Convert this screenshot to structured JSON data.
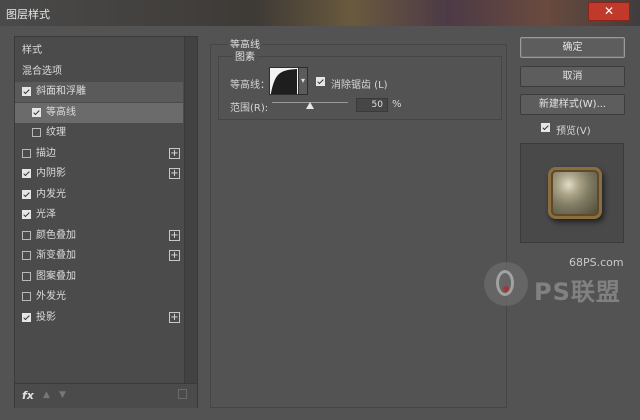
{
  "window": {
    "title": "图层样式",
    "close_icon": "✕",
    "close_color": "#c0392b"
  },
  "left_panel": {
    "items": [
      {
        "label": "样式",
        "checkbox": null,
        "plus": false,
        "state": ""
      },
      {
        "label": "混合选项",
        "checkbox": null,
        "plus": false,
        "state": ""
      },
      {
        "label": "斜面和浮雕",
        "checkbox": true,
        "plus": false,
        "state": "sel-head"
      },
      {
        "label": "等高线",
        "checkbox": true,
        "plus": false,
        "state": "sel",
        "indent": true
      },
      {
        "label": "纹理",
        "checkbox": false,
        "plus": false,
        "state": "",
        "indent": true
      },
      {
        "label": "描边",
        "checkbox": false,
        "plus": true,
        "state": ""
      },
      {
        "label": "内阴影",
        "checkbox": true,
        "plus": true,
        "state": ""
      },
      {
        "label": "内发光",
        "checkbox": true,
        "plus": false,
        "state": ""
      },
      {
        "label": "光泽",
        "checkbox": true,
        "plus": false,
        "state": ""
      },
      {
        "label": "颜色叠加",
        "checkbox": false,
        "plus": true,
        "state": ""
      },
      {
        "label": "渐变叠加",
        "checkbox": false,
        "plus": true,
        "state": ""
      },
      {
        "label": "图案叠加",
        "checkbox": false,
        "plus": false,
        "state": ""
      },
      {
        "label": "外发光",
        "checkbox": false,
        "plus": false,
        "state": ""
      },
      {
        "label": "投影",
        "checkbox": true,
        "plus": true,
        "state": ""
      }
    ],
    "footer": {
      "fx_label": "fx",
      "up_icon": "▲",
      "down_icon": "▼"
    }
  },
  "contour": {
    "group_title": "等高线",
    "sub_title": "图素",
    "contour_label": "等高线：",
    "dropdown_icon": "▾",
    "antialias_label": "消除锯齿 (L)",
    "antialias_checked": true,
    "range_label": "范围(R):",
    "range_value": "50",
    "range_unit": "%"
  },
  "buttons": {
    "ok": "确定",
    "cancel": "取消",
    "new_style": "新建样式(W)...",
    "preview_label": "预览(V)",
    "preview_checked": true
  },
  "watermark": {
    "site": "68PS.com",
    "brand": "PS联盟"
  }
}
